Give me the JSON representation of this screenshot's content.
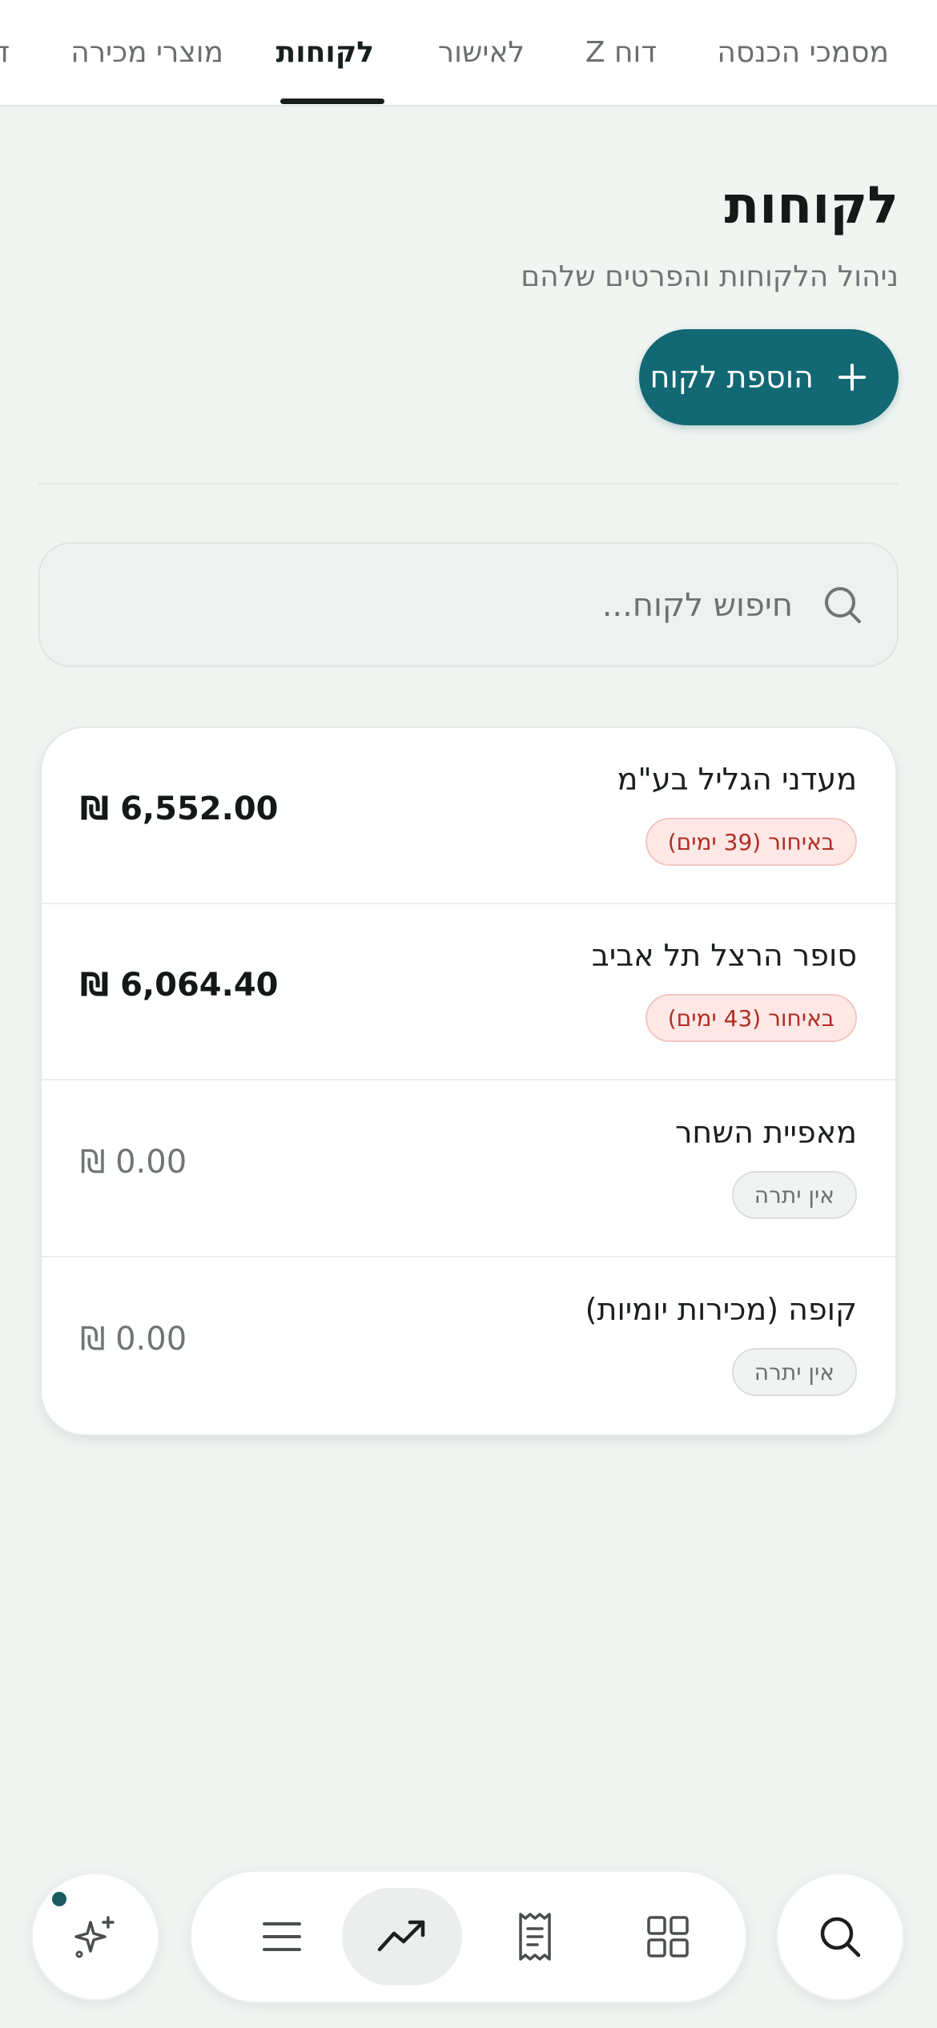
{
  "tabs": [
    {
      "label": "מסמכי הכנסה",
      "active": false
    },
    {
      "label": "דוח Z",
      "active": false
    },
    {
      "label": "לאישור",
      "active": false
    },
    {
      "label": "לקוחות",
      "active": true
    },
    {
      "label": "מוצרי מכירה",
      "active": false
    },
    {
      "label": "ד",
      "active": false
    }
  ],
  "header": {
    "title": "לקוחות",
    "subtitle": "ניהול הלקוחות והפרטים שלהם",
    "add_button_label": "הוספת לקוח"
  },
  "search": {
    "placeholder": "חיפוש לקוח...",
    "value": ""
  },
  "customers": [
    {
      "name": "מעדני הגליל בע\"מ",
      "status": "באיחור (39 ימים)",
      "status_type": "overdue",
      "amount": "₪ 6,552.00"
    },
    {
      "name": "סופר הרצל תל אביב",
      "status": "באיחור (43 ימים)",
      "status_type": "overdue",
      "amount": "₪ 6,064.40"
    },
    {
      "name": "מאפיית השחר",
      "status": "אין יתרה",
      "status_type": "none",
      "amount": "₪ 0.00"
    },
    {
      "name": "קופה (מכירות יומיות)",
      "status": "אין יתרה",
      "status_type": "none",
      "amount": "₪ 0.00"
    }
  ],
  "bottom_nav": {
    "items": [
      "grid-icon",
      "receipt-icon",
      "trending-up-icon",
      "menu-icon"
    ],
    "active": "trending-up-icon",
    "left_fab": "sparkle-icon",
    "right_fab": "search-icon"
  },
  "colors": {
    "accent": "#126873",
    "background": "#f1f5f2",
    "overdue_text": "#b02d23",
    "overdue_bg": "#fde8e6"
  }
}
